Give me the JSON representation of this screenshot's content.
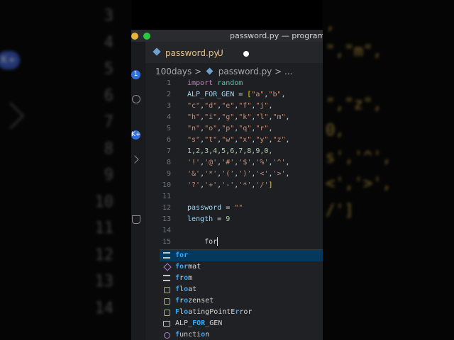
{
  "window": {
    "title": "password.py — programin"
  },
  "tab": {
    "filename": "password.py",
    "status": "U"
  },
  "breadcrumb": {
    "folder": "100days",
    "file": "password.py",
    "more": "..."
  },
  "badges": {
    "activity": "1",
    "activity2": "K+",
    "bg_badge": "K+"
  },
  "background": {
    "left_line_numbers": [
      "3",
      "4",
      "5",
      "6",
      "7",
      "8",
      "9",
      "10",
      "11",
      "12",
      "13",
      "14"
    ],
    "right_code": [
      ",",
      "\",\"m\",",
      "",
      "\",\"z\",",
      "0,",
      "s','^',",
      "<','>',",
      "/']",
      "",
      "",
      "",
      ""
    ]
  },
  "code_lines": [
    {
      "n": "1",
      "tokens": [
        [
          "kw",
          "import"
        ],
        [
          "op",
          " "
        ],
        [
          "mod",
          "random"
        ]
      ]
    },
    {
      "n": "2",
      "tokens": [
        [
          "var",
          "ALP_FOR_GEN"
        ],
        [
          "op",
          " = "
        ],
        [
          "brk",
          "["
        ],
        [
          "str",
          "\"a\""
        ],
        [
          "op",
          ","
        ],
        [
          "str",
          "\"b\""
        ],
        [
          "op",
          ","
        ]
      ]
    },
    {
      "n": "3",
      "tokens": [
        [
          "str",
          "\"c\""
        ],
        [
          "op",
          ","
        ],
        [
          "str",
          "\"d\""
        ],
        [
          "op",
          ","
        ],
        [
          "str",
          "\"e\""
        ],
        [
          "op",
          ","
        ],
        [
          "str",
          "\"f\""
        ],
        [
          "op",
          ","
        ],
        [
          "str",
          "\"j\""
        ],
        [
          "op",
          ","
        ]
      ]
    },
    {
      "n": "4",
      "tokens": [
        [
          "str",
          "\"h\""
        ],
        [
          "op",
          ","
        ],
        [
          "str",
          "\"i\""
        ],
        [
          "op",
          ","
        ],
        [
          "str",
          "\"g\""
        ],
        [
          "op",
          ","
        ],
        [
          "str",
          "\"k\""
        ],
        [
          "op",
          ","
        ],
        [
          "str",
          "\"l\""
        ],
        [
          "op",
          ","
        ],
        [
          "str",
          "\"m\""
        ],
        [
          "op",
          ","
        ]
      ]
    },
    {
      "n": "5",
      "tokens": [
        [
          "str",
          "\"n\""
        ],
        [
          "op",
          ","
        ],
        [
          "str",
          "\"o\""
        ],
        [
          "op",
          ","
        ],
        [
          "str",
          "\"p\""
        ],
        [
          "op",
          ","
        ],
        [
          "str",
          "\"q\""
        ],
        [
          "op",
          ","
        ],
        [
          "str",
          "\"r\""
        ],
        [
          "op",
          ","
        ]
      ]
    },
    {
      "n": "6",
      "tokens": [
        [
          "str",
          "\"s\""
        ],
        [
          "op",
          ","
        ],
        [
          "str",
          "\"t\""
        ],
        [
          "op",
          ","
        ],
        [
          "str",
          "\"w\""
        ],
        [
          "op",
          ","
        ],
        [
          "str",
          "\"x\""
        ],
        [
          "op",
          ","
        ],
        [
          "str",
          "\"y\""
        ],
        [
          "op",
          ","
        ],
        [
          "str",
          "\"z\""
        ],
        [
          "op",
          ","
        ]
      ]
    },
    {
      "n": "7",
      "tokens": [
        [
          "num",
          "1,2,3,4,5,6,7,8,9,0,"
        ]
      ]
    },
    {
      "n": "8",
      "tokens": [
        [
          "str",
          "'!'"
        ],
        [
          "op",
          ","
        ],
        [
          "str",
          "'@'"
        ],
        [
          "op",
          ","
        ],
        [
          "str",
          "'#'"
        ],
        [
          "op",
          ","
        ],
        [
          "str",
          "'$'"
        ],
        [
          "op",
          ","
        ],
        [
          "str",
          "'%'"
        ],
        [
          "op",
          ","
        ],
        [
          "str",
          "'^'"
        ],
        [
          "op",
          ","
        ]
      ]
    },
    {
      "n": "9",
      "tokens": [
        [
          "str",
          "'&'"
        ],
        [
          "op",
          ","
        ],
        [
          "str",
          "'*'"
        ],
        [
          "op",
          ","
        ],
        [
          "str",
          "'('"
        ],
        [
          "op",
          ","
        ],
        [
          "str",
          "')'"
        ],
        [
          "op",
          ","
        ],
        [
          "str",
          "'<'"
        ],
        [
          "op",
          ","
        ],
        [
          "str",
          "'>'"
        ],
        [
          "op",
          ","
        ]
      ]
    },
    {
      "n": "10",
      "tokens": [
        [
          "str",
          "'?'"
        ],
        [
          "op",
          ","
        ],
        [
          "str",
          "'+'"
        ],
        [
          "op",
          ","
        ],
        [
          "str",
          "'-'"
        ],
        [
          "op",
          ","
        ],
        [
          "str",
          "'*'"
        ],
        [
          "op",
          ","
        ],
        [
          "str",
          "'/'"
        ],
        [
          "brk",
          "]"
        ]
      ]
    },
    {
      "n": "11",
      "tokens": []
    },
    {
      "n": "12",
      "tokens": [
        [
          "var",
          "password"
        ],
        [
          "op",
          " = "
        ],
        [
          "str",
          "\"\""
        ]
      ]
    },
    {
      "n": "13",
      "tokens": [
        [
          "var",
          "length"
        ],
        [
          "op",
          " = "
        ],
        [
          "num",
          "9"
        ]
      ]
    },
    {
      "n": "14",
      "tokens": []
    },
    {
      "n": "15",
      "tokens": [
        [
          "op",
          "    for"
        ]
      ],
      "cursor": true
    }
  ],
  "suggestions": [
    {
      "icon": "keyword-icon",
      "match": "for",
      "rest": "",
      "selected": true
    },
    {
      "icon": "method-icon",
      "match": "for",
      "rest": "mat",
      "selected": false
    },
    {
      "icon": "keyword-icon",
      "match": "f",
      "rest": "r",
      "mid": "o",
      "pre": "",
      "label": "from",
      "selected": false
    },
    {
      "icon": "class-icon",
      "label": "float",
      "selected": false
    },
    {
      "icon": "class-icon",
      "label": "frozenset",
      "selected": false
    },
    {
      "icon": "class-icon",
      "label": "FloatingPointError",
      "selected": false
    },
    {
      "icon": "variable-icon",
      "label": "ALP_FOR_GEN",
      "selected": false
    },
    {
      "icon": "function-icon",
      "label": "function",
      "selected": false
    }
  ]
}
